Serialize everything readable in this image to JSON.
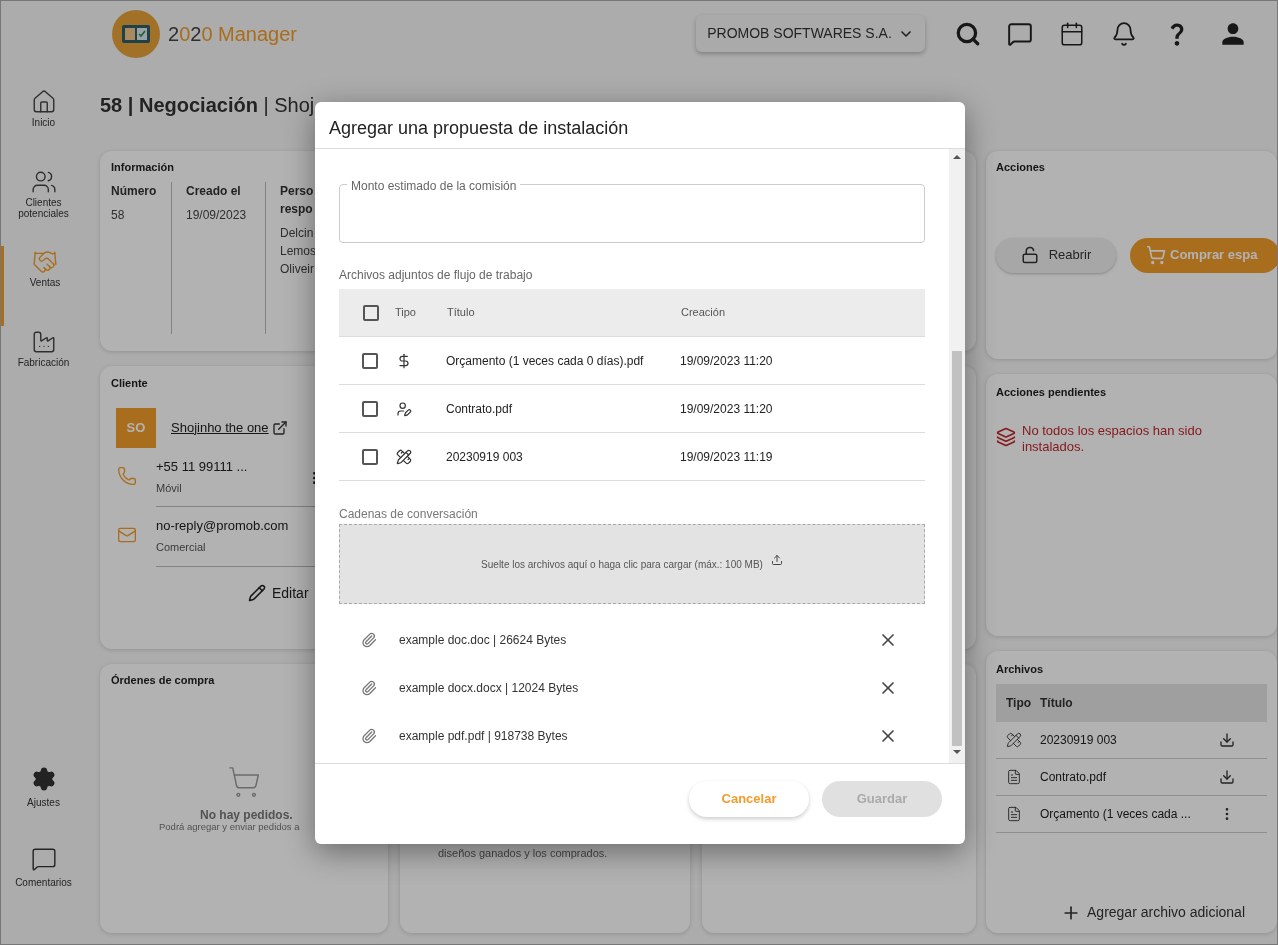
{
  "header": {
    "logo": {
      "number": "2020",
      "name": "Manager"
    },
    "company": "PROMOB SOFTWARES S.A."
  },
  "sidebar": {
    "items": [
      {
        "label": "Inicio",
        "selected": false
      },
      {
        "label": "Clientes potenciales",
        "selected": false
      },
      {
        "label": "Ventas",
        "selected": true
      },
      {
        "label": "Fabricación",
        "selected": false
      }
    ],
    "bottom_items": [
      "Ajustes",
      "Comentarios"
    ]
  },
  "page_title": "**58 | Negociación** | Shoj",
  "info": {
    "title": "Información",
    "columns": [
      {
        "label_lines": [
          "Número"
        ],
        "values": [
          "58"
        ]
      },
      {
        "label_lines": [
          "Creado el"
        ],
        "values": [
          "19/09/2023"
        ]
      },
      {
        "label_lines": [
          "Perso",
          "respo"
        ],
        "values": [
          "Delcin",
          "Lemos",
          "Oliveir"
        ]
      }
    ]
  },
  "client": {
    "title": "Cliente",
    "initials": "SO",
    "name": "Shojinho the one",
    "contacts": [
      {
        "kind": "phone",
        "value": "+55 11 99111 ...",
        "type": "Móvil"
      },
      {
        "kind": "email",
        "value": "no-reply@promob.com",
        "type": "Comercial"
      }
    ],
    "edit": "Editar"
  },
  "orders": {
    "title": "Órdenes de compra",
    "empty_title": "No hay pedidos.",
    "empty_text": "Podrá agregar y enviar pedidos a"
  },
  "designs_card": {
    "text": "diseños ganados y los comprados."
  },
  "actions": {
    "title": "Acciones",
    "buttons": [
      {
        "kind": "secondary",
        "label": "Reabrir"
      },
      {
        "kind": "primary",
        "label": "Comprar espa"
      }
    ]
  },
  "pending": {
    "title": "Acciones pendientes",
    "items": [
      "No todos los espacios han sido instalados."
    ]
  },
  "files": {
    "title": "Archivos",
    "columns": [
      "Tipo",
      "Título"
    ],
    "rows": [
      {
        "kind": "design",
        "title": "20230919 003",
        "action": {
          "kind": "download"
        }
      },
      {
        "kind": "pdf",
        "title": "Contrato.pdf",
        "action": {
          "kind": "download"
        }
      },
      {
        "kind": "pdf",
        "title": "Orçamento (1 veces cada ...",
        "action": {
          "kind": "menu"
        }
      }
    ],
    "add": "Agregar archivo adicional"
  },
  "dialog": {
    "title": "Agregar una propuesta de instalación",
    "commission_field": {
      "label": "Monto estimado de la comisión"
    },
    "attachments": {
      "label": "Archivos adjuntos de flujo de trabajo",
      "header_checked": false,
      "columns": [
        "Tipo",
        "Título",
        "Creación"
      ],
      "rows": [
        {
          "kind": "budget",
          "title": "Orçamento (1 veces cada 0 días).pdf",
          "created": "19/09/2023 11:20",
          "checked": false
        },
        {
          "kind": "contract",
          "title": "Contrato.pdf",
          "created": "19/09/2023 11:20",
          "checked": false
        },
        {
          "kind": "design",
          "title": "20230919 003",
          "created": "19/09/2023 11:19",
          "checked": false
        }
      ]
    },
    "threads": {
      "label": "Cadenas de conversación",
      "dropzone": "Suelte los archivos aquí o haga clic para cargar (máx.: 100 MB)",
      "files": [
        "example doc.doc | 26624 Bytes",
        "example docx.docx | 12024 Bytes",
        "example pdf.pdf | 918738 Bytes"
      ]
    },
    "buttons": [
      {
        "kind": "cancel",
        "label": "Cancelar",
        "disabled": false
      },
      {
        "kind": "save",
        "label": "Guardar",
        "disabled": true
      }
    ]
  }
}
